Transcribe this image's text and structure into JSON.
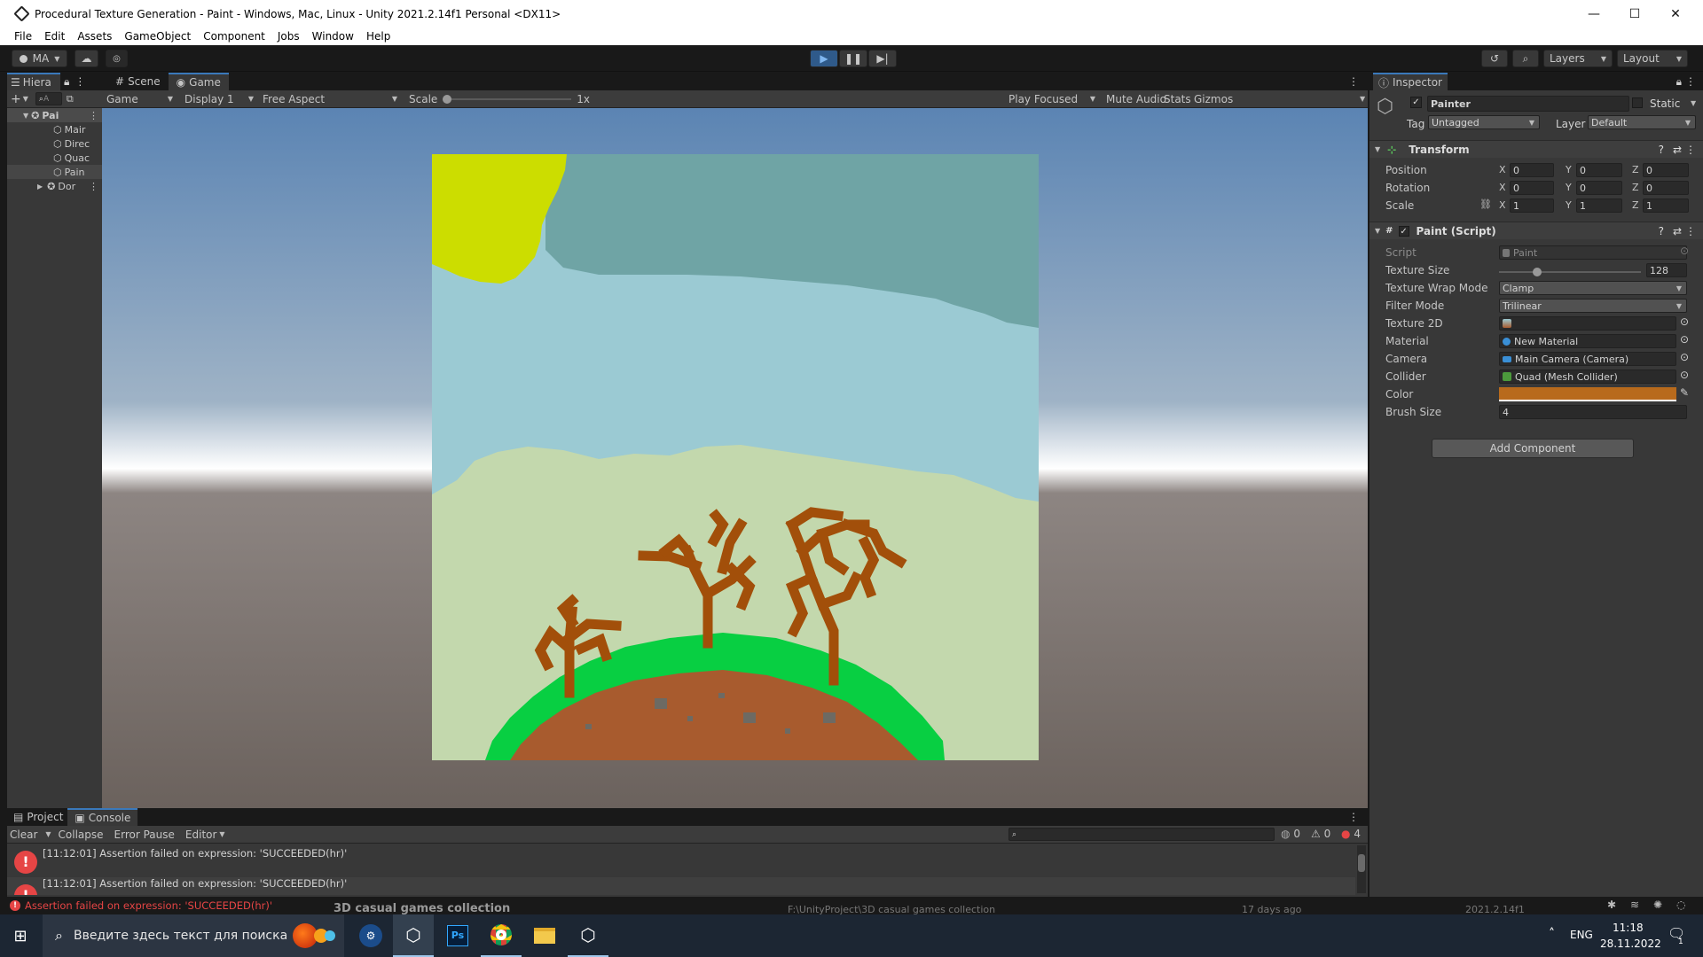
{
  "window": {
    "title": "Procedural Texture Generation - Paint - Windows, Mac, Linux - Unity 2021.2.14f1 Personal <DX11>",
    "minimize": "—",
    "maximize": "☐",
    "close": "✕"
  },
  "menu": [
    "File",
    "Edit",
    "Assets",
    "GameObject",
    "Component",
    "Jobs",
    "Window",
    "Help"
  ],
  "toolbar": {
    "account": "MA",
    "layers": "Layers",
    "layout": "Layout"
  },
  "hierarchy": {
    "tab": "Hiera",
    "search": "A",
    "items": [
      {
        "label": "Pai",
        "indent": 0
      },
      {
        "label": "Mair",
        "indent": 1
      },
      {
        "label": "Direc",
        "indent": 1
      },
      {
        "label": "Quac",
        "indent": 1
      },
      {
        "label": "Pain",
        "indent": 1
      },
      {
        "label": "Dor",
        "indent": 0
      }
    ]
  },
  "game": {
    "tabs": [
      "Scene",
      "Game"
    ],
    "view": "Game",
    "display": "Display 1",
    "aspect": "Free Aspect",
    "scale_label": "Scale",
    "scale_value": "1x",
    "play_focused": "Play Focused",
    "mute": "Mute Audio",
    "stats": "Stats",
    "gizmos": "Gizmos",
    "colors": {
      "sky_top": "#5b84b3",
      "horizon": "#ffffff",
      "ground": "#6b625d",
      "sun": "#ccdd00",
      "sky": "#9bcad3",
      "sky_dark": "#6fa4a5",
      "field": "#c3d8ad",
      "grass": "#08cf42",
      "dirt": "#a85b2e",
      "tree": "#a24f0a",
      "stone": "#6d6a63"
    }
  },
  "inspector": {
    "tab": "Inspector",
    "name": "Painter",
    "static": "Static",
    "tag_label": "Tag",
    "tag": "Untagged",
    "layer_label": "Layer",
    "layer": "Default",
    "transform": {
      "title": "Transform",
      "rows": [
        {
          "label": "Position",
          "x": "0",
          "y": "0",
          "z": "0"
        },
        {
          "label": "Rotation",
          "x": "0",
          "y": "0",
          "z": "0"
        },
        {
          "label": "Scale",
          "x": "1",
          "y": "1",
          "z": "1"
        }
      ]
    },
    "script": {
      "title": "Paint (Script)",
      "script_label": "Script",
      "script": "Paint",
      "texture_size_label": "Texture Size",
      "texture_size": "128",
      "wrap_label": "Texture Wrap Mode",
      "wrap": "Clamp",
      "filter_label": "Filter Mode",
      "filter": "Trilinear",
      "tex2d_label": "Texture 2D",
      "material_label": "Material",
      "material": "New Material",
      "camera_label": "Camera",
      "camera": "Main Camera (Camera)",
      "collider_label": "Collider",
      "collider": "Quad (Mesh Collider)",
      "color_label": "Color",
      "color": "#b86a1c",
      "brush_label": "Brush Size",
      "brush": "4"
    },
    "add_component": "Add Component"
  },
  "console": {
    "tabs": [
      "Project",
      "Console"
    ],
    "clear": "Clear",
    "collapse": "Collapse",
    "error_pause": "Error Pause",
    "editor": "Editor",
    "count_info": "0",
    "count_warn": "0",
    "count_err": "4",
    "messages": [
      "[11:12:01] Assertion failed on expression: 'SUCCEEDED(hr)'",
      "[11:12:01] Assertion failed on expression: 'SUCCEEDED(hr)'"
    ]
  },
  "status": {
    "text": "Assertion failed on expression: 'SUCCEEDED(hr)'",
    "ghost_left": "3D casual games collection",
    "ghost_path": "F:\\UnityProject\\3D casual games collection",
    "ghost_age": "17 days ago",
    "ghost_ver": "2021.2.14f1"
  },
  "taskbar": {
    "search": "Введите здесь текст для поиска",
    "lang": "ENG",
    "time": "11:18",
    "date": "28.11.2022",
    "notif": "1"
  }
}
